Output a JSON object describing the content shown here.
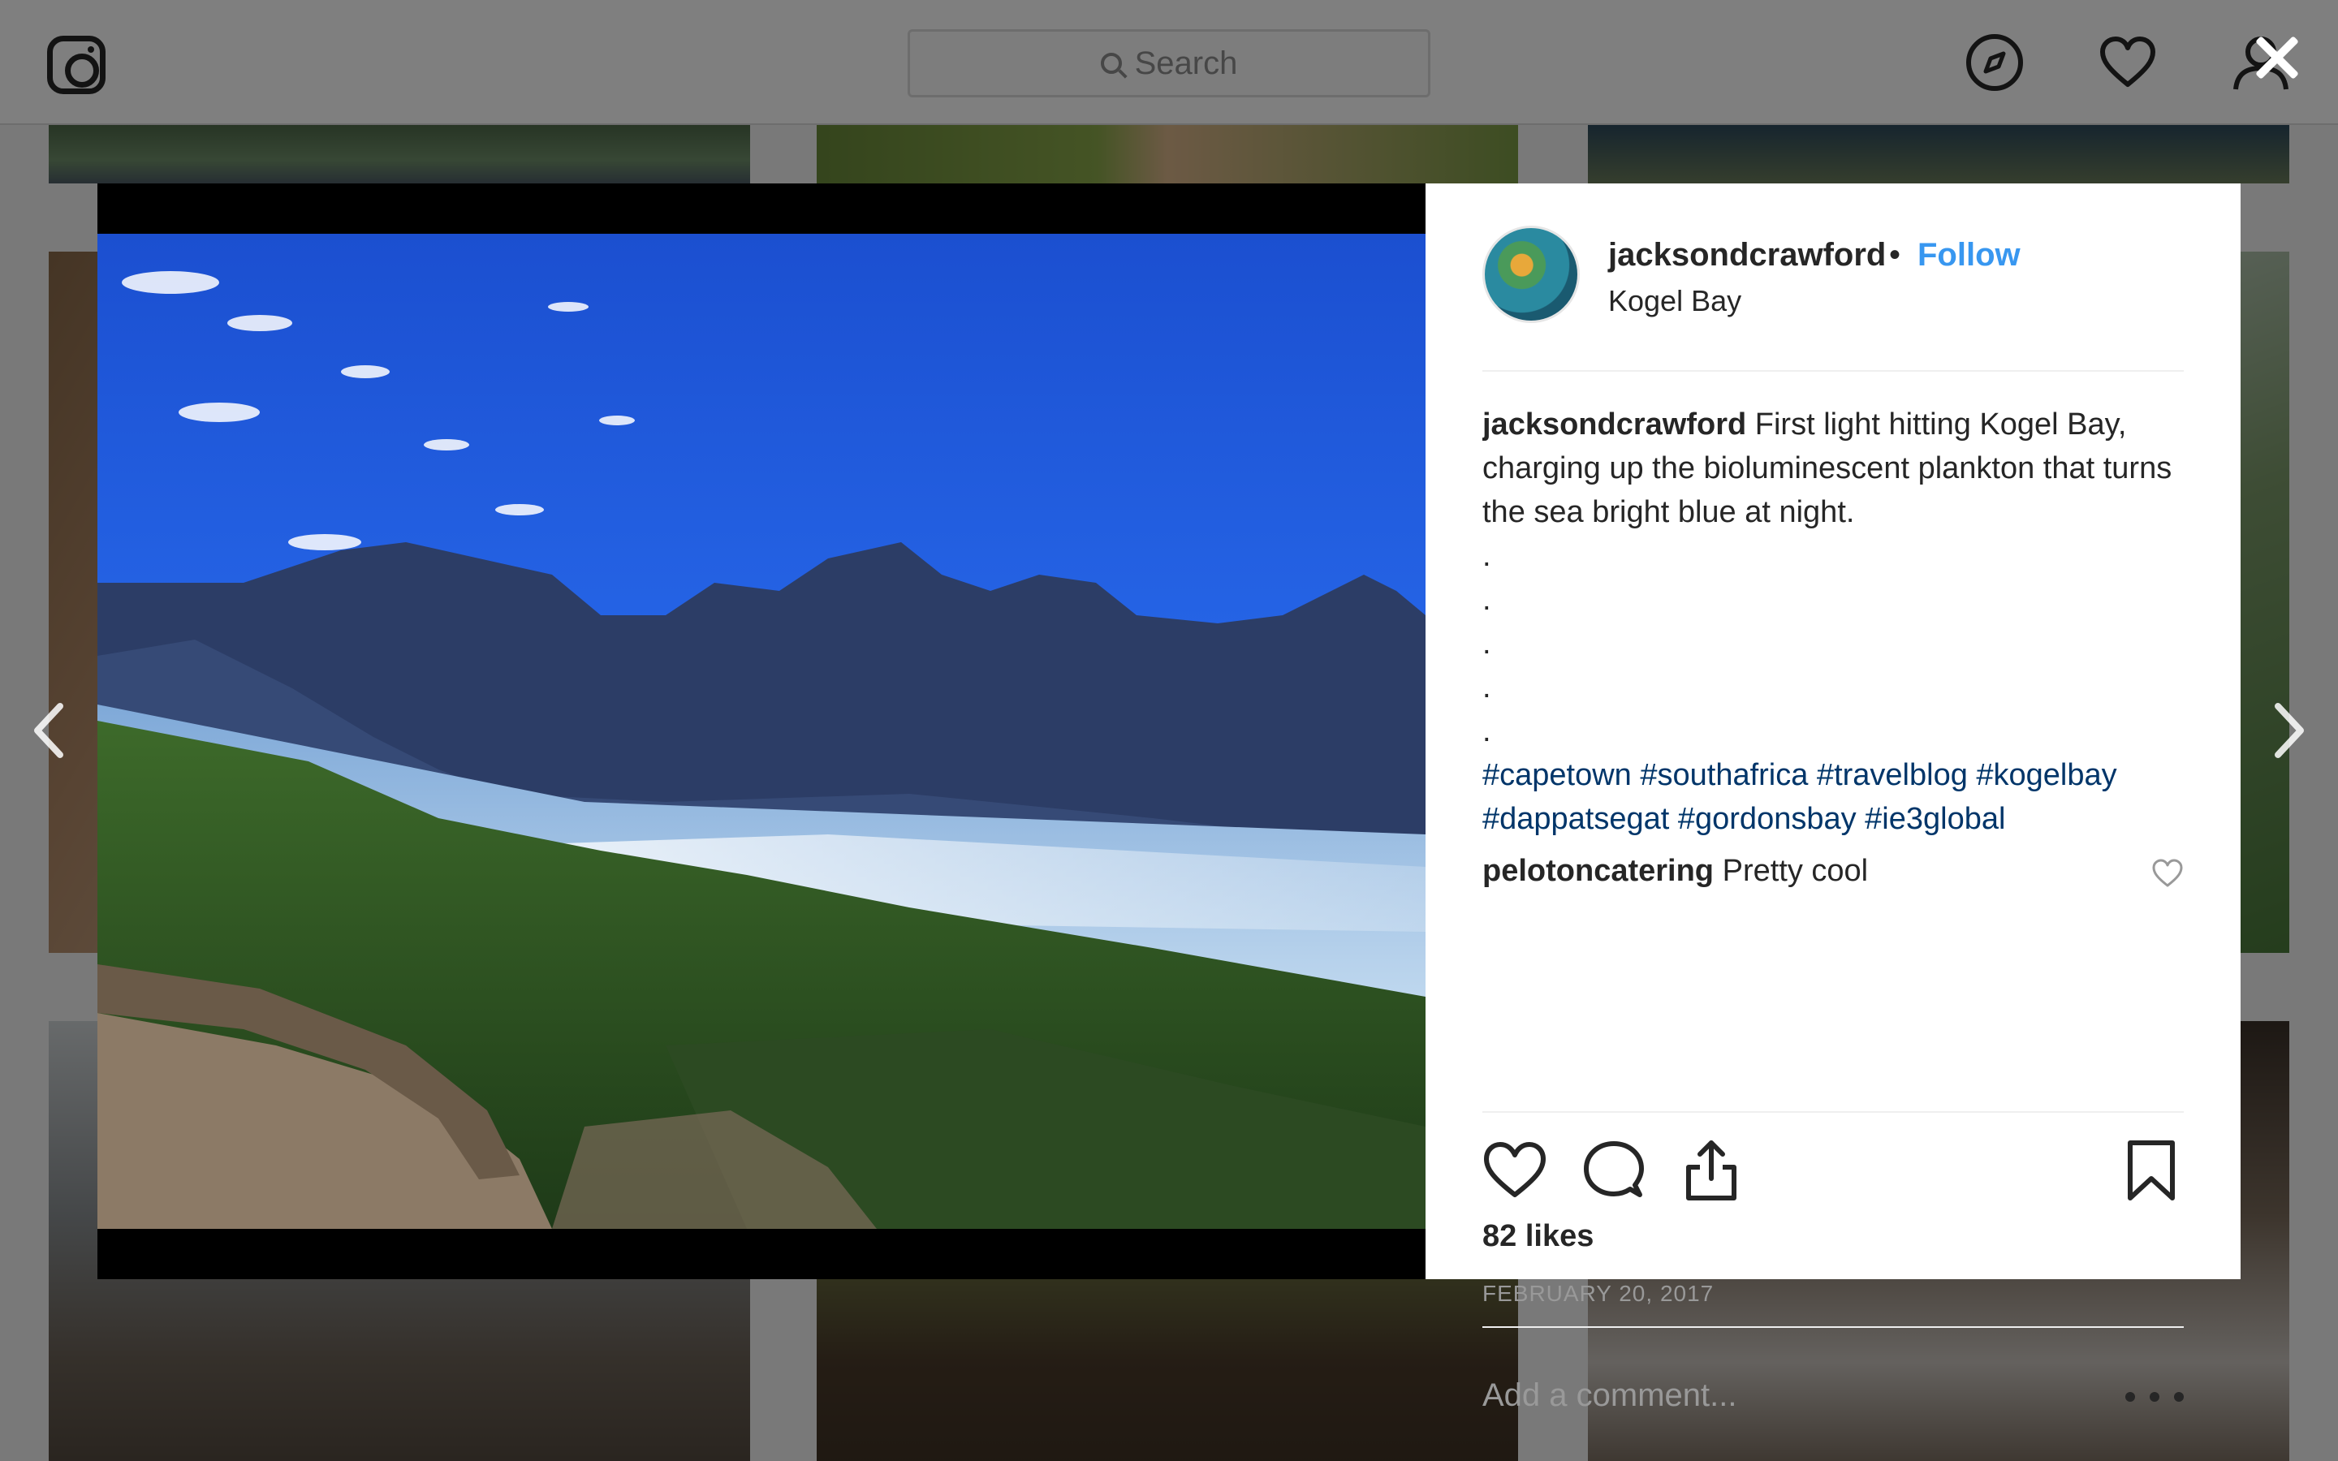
{
  "topbar": {
    "search_placeholder": "Search",
    "icons": [
      "instagram-logo",
      "search-icon",
      "compass-icon",
      "heart-icon",
      "profile-icon"
    ]
  },
  "viewer": {
    "icons": [
      "close-icon",
      "chevron-left-icon",
      "chevron-right-icon"
    ],
    "overlay_color": "#000000"
  },
  "post": {
    "username": "jacksondcrawford",
    "separator": "•",
    "follow_label": "Follow",
    "location": "Kogel Bay",
    "caption": {
      "username": "jacksondcrawford",
      "text": "First light hitting Kogel Bay, charging up the bioluminescent plankton that turns the sea bright blue at night.",
      "dots": [
        ".",
        ".",
        ".",
        ".",
        "."
      ],
      "hashtags_line1": "#capetown #southafrica #travelblog #kogelbay",
      "hashtags_line2": "#dappatsegat #gordonsbay #ie3global"
    },
    "comments": [
      {
        "username": "pelotoncatering",
        "text": "Pretty cool"
      }
    ],
    "likes": "82 likes",
    "date": "FEBRUARY 20, 2017",
    "add_comment_placeholder": "Add a comment...",
    "action_icons": [
      "heart-icon",
      "comment-icon",
      "share-icon",
      "bookmark-icon"
    ],
    "colors": {
      "follow": "#3897f0",
      "hashtag": "#003569",
      "text": "#262626",
      "muted": "#999999"
    }
  }
}
